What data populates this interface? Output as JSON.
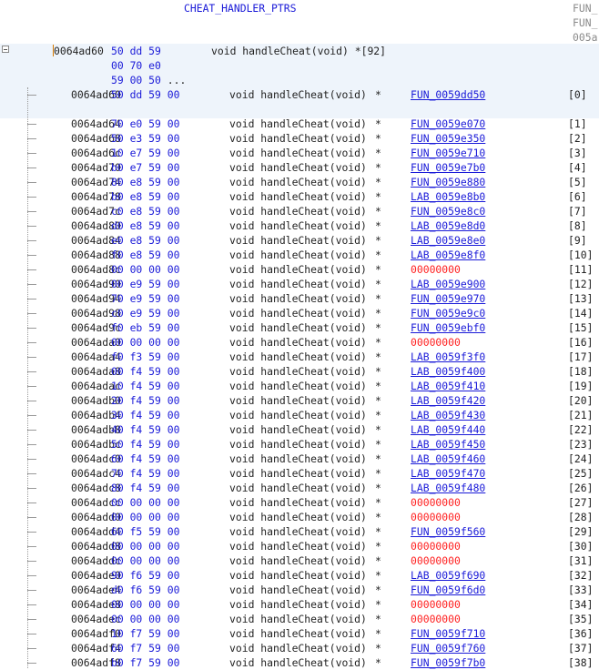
{
  "header": {
    "label": "CHEAT_HANDLER_PTRS",
    "xrefs": [
      "FUN_",
      "FUN_",
      "005a"
    ]
  },
  "array_def": {
    "address": "0064ad60",
    "bytes_lines": [
      "50 dd 59",
      "00 70 e0",
      "59 00 50"
    ],
    "ellipsis": "...",
    "declaration": "void handleCheat(void) *[92]"
  },
  "colors": {
    "label": "#1a1ad8",
    "bytes": "#1a1ad8",
    "null_pointer": "#ff2020",
    "address_marker": "#d47900",
    "selection_bg": "#eef4fb"
  },
  "rows": [
    {
      "addr": "0064ad60",
      "bytes": "50 dd 59 00",
      "type": "void handleCheat(void)",
      "star": "*",
      "target": "FUN_0059dd50",
      "idx": "[0]"
    },
    {
      "addr": "0064ad64",
      "bytes": "70 e0 59 00",
      "type": "void handleCheat(void)",
      "star": "*",
      "target": "FUN_0059e070",
      "idx": "[1]"
    },
    {
      "addr": "0064ad68",
      "bytes": "50 e3 59 00",
      "type": "void handleCheat(void)",
      "star": "*",
      "target": "FUN_0059e350",
      "idx": "[2]"
    },
    {
      "addr": "0064ad6c",
      "bytes": "10 e7 59 00",
      "type": "void handleCheat(void)",
      "star": "*",
      "target": "FUN_0059e710",
      "idx": "[3]"
    },
    {
      "addr": "0064ad70",
      "bytes": "b0 e7 59 00",
      "type": "void handleCheat(void)",
      "star": "*",
      "target": "FUN_0059e7b0",
      "idx": "[4]"
    },
    {
      "addr": "0064ad74",
      "bytes": "80 e8 59 00",
      "type": "void handleCheat(void)",
      "star": "*",
      "target": "FUN_0059e880",
      "idx": "[5]"
    },
    {
      "addr": "0064ad78",
      "bytes": "b0 e8 59 00",
      "type": "void handleCheat(void)",
      "star": "*",
      "target": "LAB_0059e8b0",
      "idx": "[6]"
    },
    {
      "addr": "0064ad7c",
      "bytes": "c0 e8 59 00",
      "type": "void handleCheat(void)",
      "star": "*",
      "target": "FUN_0059e8c0",
      "idx": "[7]"
    },
    {
      "addr": "0064ad80",
      "bytes": "d0 e8 59 00",
      "type": "void handleCheat(void)",
      "star": "*",
      "target": "LAB_0059e8d0",
      "idx": "[8]"
    },
    {
      "addr": "0064ad84",
      "bytes": "e0 e8 59 00",
      "type": "void handleCheat(void)",
      "star": "*",
      "target": "LAB_0059e8e0",
      "idx": "[9]"
    },
    {
      "addr": "0064ad88",
      "bytes": "f0 e8 59 00",
      "type": "void handleCheat(void)",
      "star": "*",
      "target": "LAB_0059e8f0",
      "idx": "[10]"
    },
    {
      "addr": "0064ad8c",
      "bytes": "00 00 00 00",
      "type": "void handleCheat(void)",
      "star": "*",
      "target": "00000000",
      "idx": "[11]",
      "null": true
    },
    {
      "addr": "0064ad90",
      "bytes": "00 e9 59 00",
      "type": "void handleCheat(void)",
      "star": "*",
      "target": "LAB_0059e900",
      "idx": "[12]"
    },
    {
      "addr": "0064ad94",
      "bytes": "70 e9 59 00",
      "type": "void handleCheat(void)",
      "star": "*",
      "target": "FUN_0059e970",
      "idx": "[13]"
    },
    {
      "addr": "0064ad98",
      "bytes": "c0 e9 59 00",
      "type": "void handleCheat(void)",
      "star": "*",
      "target": "FUN_0059e9c0",
      "idx": "[14]"
    },
    {
      "addr": "0064ad9c",
      "bytes": "f0 eb 59 00",
      "type": "void handleCheat(void)",
      "star": "*",
      "target": "FUN_0059ebf0",
      "idx": "[15]"
    },
    {
      "addr": "0064ada0",
      "bytes": "00 00 00 00",
      "type": "void handleCheat(void)",
      "star": "*",
      "target": "00000000",
      "idx": "[16]",
      "null": true
    },
    {
      "addr": "0064ada4",
      "bytes": "f0 f3 59 00",
      "type": "void handleCheat(void)",
      "star": "*",
      "target": "LAB_0059f3f0",
      "idx": "[17]"
    },
    {
      "addr": "0064ada8",
      "bytes": "00 f4 59 00",
      "type": "void handleCheat(void)",
      "star": "*",
      "target": "LAB_0059f400",
      "idx": "[18]"
    },
    {
      "addr": "0064adac",
      "bytes": "10 f4 59 00",
      "type": "void handleCheat(void)",
      "star": "*",
      "target": "LAB_0059f410",
      "idx": "[19]"
    },
    {
      "addr": "0064adb0",
      "bytes": "20 f4 59 00",
      "type": "void handleCheat(void)",
      "star": "*",
      "target": "LAB_0059f420",
      "idx": "[20]"
    },
    {
      "addr": "0064adb4",
      "bytes": "30 f4 59 00",
      "type": "void handleCheat(void)",
      "star": "*",
      "target": "LAB_0059f430",
      "idx": "[21]"
    },
    {
      "addr": "0064adb8",
      "bytes": "40 f4 59 00",
      "type": "void handleCheat(void)",
      "star": "*",
      "target": "LAB_0059f440",
      "idx": "[22]"
    },
    {
      "addr": "0064adbc",
      "bytes": "50 f4 59 00",
      "type": "void handleCheat(void)",
      "star": "*",
      "target": "LAB_0059f450",
      "idx": "[23]"
    },
    {
      "addr": "0064adc0",
      "bytes": "60 f4 59 00",
      "type": "void handleCheat(void)",
      "star": "*",
      "target": "LAB_0059f460",
      "idx": "[24]"
    },
    {
      "addr": "0064adc4",
      "bytes": "70 f4 59 00",
      "type": "void handleCheat(void)",
      "star": "*",
      "target": "LAB_0059f470",
      "idx": "[25]"
    },
    {
      "addr": "0064adc8",
      "bytes": "80 f4 59 00",
      "type": "void handleCheat(void)",
      "star": "*",
      "target": "LAB_0059f480",
      "idx": "[26]"
    },
    {
      "addr": "0064adcc",
      "bytes": "00 00 00 00",
      "type": "void handleCheat(void)",
      "star": "*",
      "target": "00000000",
      "idx": "[27]",
      "null": true
    },
    {
      "addr": "0064add0",
      "bytes": "00 00 00 00",
      "type": "void handleCheat(void)",
      "star": "*",
      "target": "00000000",
      "idx": "[28]",
      "null": true
    },
    {
      "addr": "0064add4",
      "bytes": "60 f5 59 00",
      "type": "void handleCheat(void)",
      "star": "*",
      "target": "FUN_0059f560",
      "idx": "[29]"
    },
    {
      "addr": "0064add8",
      "bytes": "00 00 00 00",
      "type": "void handleCheat(void)",
      "star": "*",
      "target": "00000000",
      "idx": "[30]",
      "null": true
    },
    {
      "addr": "0064addc",
      "bytes": "00 00 00 00",
      "type": "void handleCheat(void)",
      "star": "*",
      "target": "00000000",
      "idx": "[31]",
      "null": true
    },
    {
      "addr": "0064ade0",
      "bytes": "90 f6 59 00",
      "type": "void handleCheat(void)",
      "star": "*",
      "target": "LAB_0059f690",
      "idx": "[32]"
    },
    {
      "addr": "0064ade4",
      "bytes": "d0 f6 59 00",
      "type": "void handleCheat(void)",
      "star": "*",
      "target": "FUN_0059f6d0",
      "idx": "[33]"
    },
    {
      "addr": "0064ade8",
      "bytes": "00 00 00 00",
      "type": "void handleCheat(void)",
      "star": "*",
      "target": "00000000",
      "idx": "[34]",
      "null": true
    },
    {
      "addr": "0064adec",
      "bytes": "00 00 00 00",
      "type": "void handleCheat(void)",
      "star": "*",
      "target": "00000000",
      "idx": "[35]",
      "null": true
    },
    {
      "addr": "0064adf0",
      "bytes": "10 f7 59 00",
      "type": "void handleCheat(void)",
      "star": "*",
      "target": "FUN_0059f710",
      "idx": "[36]"
    },
    {
      "addr": "0064adf4",
      "bytes": "60 f7 59 00",
      "type": "void handleCheat(void)",
      "star": "*",
      "target": "FUN_0059f760",
      "idx": "[37]"
    },
    {
      "addr": "0064adf8",
      "bytes": "b0 f7 59 00",
      "type": "void handleCheat(void)",
      "star": "*",
      "target": "FUN_0059f7b0",
      "idx": "[38]"
    }
  ]
}
